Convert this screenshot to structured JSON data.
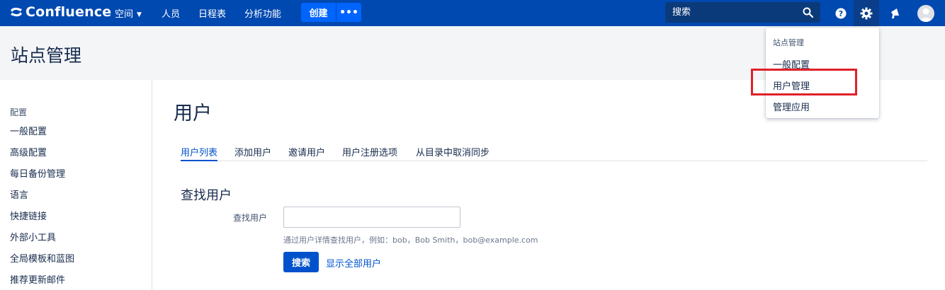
{
  "colors": {
    "nav_bg": "#0049b0",
    "create_bg": "#0065ff",
    "accent": "#0052cc",
    "highlight": "#e0202a"
  },
  "nav": {
    "logo": "Confluence",
    "spaces": "空间",
    "people": "人员",
    "calendar": "日程表",
    "analytics": "分析功能",
    "create": "创建",
    "more": "•••",
    "search_placeholder": "搜索"
  },
  "page": {
    "title": "站点管理"
  },
  "sidebar": {
    "heading": "配置",
    "items": [
      "一般配置",
      "高级配置",
      "每日备份管理",
      "语言",
      "快捷链接",
      "外部小工具",
      "全局模板和蓝图",
      "推荐更新邮件"
    ]
  },
  "main": {
    "title": "用户",
    "tabs": [
      "用户列表",
      "添加用户",
      "邀请用户",
      "用户注册选项",
      "从目录中取消同步"
    ],
    "active_tab": "用户列表",
    "section_title": "查找用户",
    "field_label": "查找用户",
    "field_value": "",
    "field_help": "通过用户详情查找用户，例如：bob，Bob Smith，bob@example.com",
    "search_button": "搜索",
    "show_all_link": "显示全部用户"
  },
  "admin_menu": {
    "heading": "站点管理",
    "items": [
      "一般配置",
      "用户管理",
      "管理应用"
    ],
    "highlighted": "用户管理"
  }
}
